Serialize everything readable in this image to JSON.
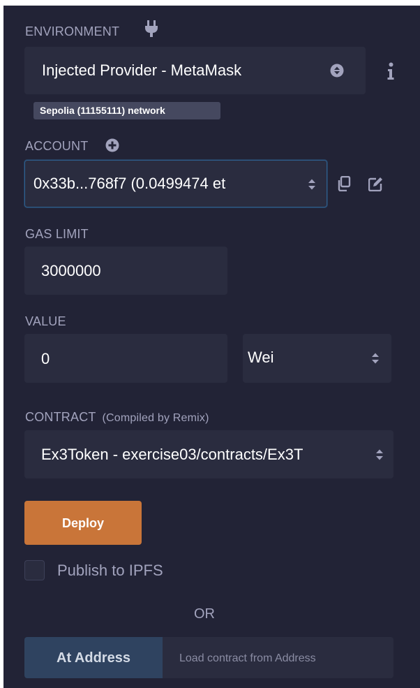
{
  "environment": {
    "label": "ENVIRONMENT",
    "icon": "plug-icon",
    "selected": "Injected Provider - MetaMask",
    "network_badge": "Sepolia (11155111) network",
    "info_icon": "info-icon"
  },
  "account": {
    "label": "ACCOUNT",
    "selected": "0x33b...768f7 (0.0499474 et",
    "add_icon": "plus-circle-icon",
    "copy_icon": "copy-icon",
    "edit_icon": "edit-icon"
  },
  "gas_limit": {
    "label": "GAS LIMIT",
    "value": "3000000"
  },
  "value": {
    "label": "VALUE",
    "amount": "0",
    "unit": "Wei"
  },
  "contract": {
    "label": "CONTRACT",
    "sublabel": "(Compiled by Remix)",
    "selected": "Ex3Token - exercise03/contracts/Ex3T"
  },
  "deploy": {
    "button_label": "Deploy",
    "publish_label": "Publish to IPFS",
    "publish_checked": false
  },
  "separator_text": "OR",
  "at_address": {
    "button_label": "At Address",
    "placeholder": "Load contract from Address"
  },
  "colors": {
    "panel_bg": "#222336",
    "field_bg": "#2a2c3f",
    "label": "#a2a3bd",
    "deploy": "#c97539",
    "at_address_button": "#2f4360",
    "focus_border": "#2e5e8c"
  }
}
